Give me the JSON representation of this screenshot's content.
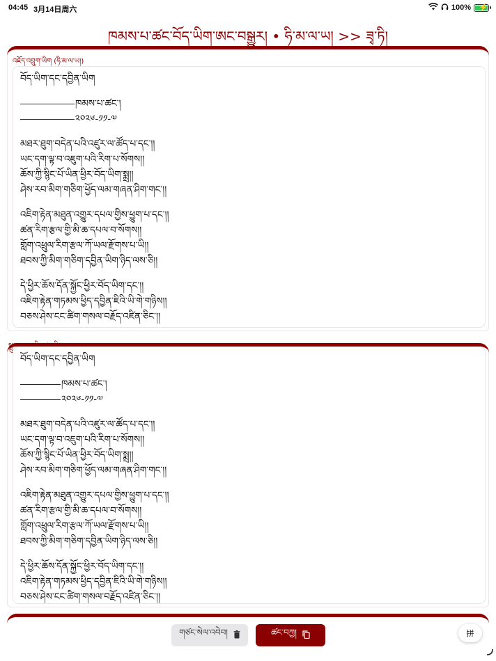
{
  "status": {
    "time": "04:45",
    "date": "3月14日周六",
    "battery": "100%",
    "battery_level": 0.9
  },
  "header": {
    "title": "ཁམས་པ་ཚང་བོད་ཡིག་ཨང་བསྒྱུར། • ཧི་མ་ལ་ཡ། >> ཟྭ་ཏི།"
  },
  "source_panel": {
    "label": "འཇོད་འབྲུག་ཡིག (ཧི་མ་ལ་ཡ།)",
    "lines": [
      "བོད་ཡིག་དང་དབྱིན་ཡིག",
      "",
      "ཁམས་པ་ཚང་།",
      "༢༠༢༦-༡༡-༧",
      "",
      "མཐར་ཐུག་བདེན་པའི་འཛུར་ལ་ཚོད་པ་དང་།།",
      "ཡང་དག་ལྟ་བ་འཇུག་པའི་རིག་པ་སོགས།།",
      "ཆོས་ཀྱི་སྙིང་པོ་ཡིན་ཕྱིར་བོད་ཡིག་སྨྲ།།",
      "ཤེས་རབ་མིག་གཅིག་ཕྱོད་ལམ་གཞན་ཤིག་གང་།།",
      "",
      "འཇིག་རྟེན་མཐུན་འགྱུར་དཔལ་གྱིས་ཕྱུག་པ་དང་།།",
      "ཚན་རིག་རྩལ་གྱི་མི་ཆ་དཔལ་བ་སོགས།།",
      "གློག་འཕྲུལ་རིག་རྩལ་ཀོ་ཡལ་རྫོགས་པ་ཡི།།",
      "ཐབས་ཀྱི་མིག་གཅིག་དབྱིན་ཡིག་ཉིད་ལས་ཅི།།",
      "",
      "དེ་ཕྱིར་ཆོས་དོན་སྐྱོང་ཕྱིར་བོད་ཡིག་དང་།།",
      "འཇིག་རྟེན་གཏམས་ཕྱིད་དབྱིན་ཇིའི་ཡི་གེ་གཉིས།།",
      "བཅས་ཤེས་ངང་ཚིག་གསལ་བརྗོད་འཛིན་ཅིང་།།"
    ]
  },
  "output_panel": {
    "label": "སྒྲུབ་འབྲས་ཡིག (ཟྭ་ཏི།)",
    "lines": [
      "བོད་ཡིག་དང་དབྱིན་ཡིག",
      "",
      "ཁམས་པ་ཚང་།",
      "༢༠༢༦-༡༡-༧",
      "",
      "མཐར་ཐུག་བདེན་པའི་འཛུར་ལ་ཚོད་པ་དང་།།",
      "ཡང་དག་ལྟ་བ་འཇུག་པའི་རིག་པ་སོགས།།",
      "ཆོས་ཀྱི་སྙིང་པོ་ཡིན་ཕྱིར་བོད་ཡིག་སྨྲ།།",
      "ཤེས་རབ་མིག་གཅིག་ཕྱོད་ལམ་གཞན་ཤིག་གང་།།",
      "",
      "འཇིག་རྟེན་མཐུན་འགྱུར་དཔལ་གྱིས་ཕྱུག་པ་དང་།།",
      "ཚན་རིག་རྩལ་གྱི་མི་ཆ་དཔལ་བ་སོགས།།",
      "གློག་འཕྲུལ་རིག་རྩལ་ཀོ་ཡལ་རྫོགས་པ་ཡི།།",
      "ཐབས་ཀྱི་མིག་གཅིག་དབྱིན་ཡིག་ཉིད་ལས་ཅི།།",
      "",
      "དེ་ཕྱིར་ཆོས་དོན་སྐྱོང་ཕྱིར་བོད་ཡིག་དང་།།",
      "འཇིག་རྟེན་གཏམས་ཕྱིད་དབྱིན་ཇིའི་ཡི་གེ་གཉིས།།",
      "བཅས་ཤེས་ངང་ཚིག་གསལ་བརྗོད་འཛིན་ཅིང་།།"
    ]
  },
  "toolbar": {
    "clear_label": "གཙང་སེལ་འབེབ།",
    "copy_label": "ཚང་བཀྱ།",
    "keyboard_label": "拼"
  },
  "colors": {
    "accent": "#8b0000"
  }
}
